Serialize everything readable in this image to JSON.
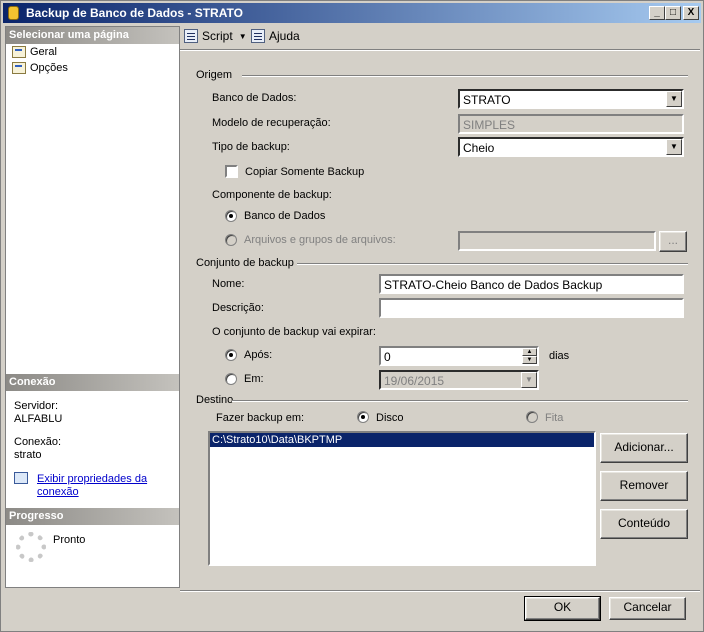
{
  "window": {
    "title": "Backup de Banco de Dados - STRATO",
    "minimize": "_",
    "maximize": "□",
    "close": "X"
  },
  "left": {
    "select_page_header": "Selecionar uma página",
    "pages": [
      {
        "label": "Geral",
        "icon": "settings-page-icon"
      },
      {
        "label": "Opções",
        "icon": "settings-page-icon"
      }
    ],
    "connection_header": "Conexão",
    "server_label": "Servidor:",
    "server_value": "ALFABLU",
    "connection_label": "Conexão:",
    "connection_value": "strato",
    "view_props_link_line1": "Exibir propriedades da",
    "view_props_link_line2": "conexão",
    "progress_header": "Progresso",
    "progress_status": "Pronto"
  },
  "toolbar": {
    "script_label": "Script",
    "help_label": "Ajuda"
  },
  "origin": {
    "group_label": "Origem",
    "database_label": "Banco de Dados:",
    "database_value": "STRATO",
    "recovery_label": "Modelo de recuperação:",
    "recovery_value": "SIMPLES",
    "backup_type_label": "Tipo de backup:",
    "backup_type_value": "Cheio",
    "copy_only_label": "Copiar Somente Backup",
    "component_label": "Componente de backup:",
    "component_db_label": "Banco de Dados",
    "component_files_label": "Arquivos e grupos de arquivos:",
    "browse_label": "..."
  },
  "backup_set": {
    "group_label": "Conjunto de backup",
    "name_label": "Nome:",
    "name_value": "STRATO-Cheio Banco de Dados Backup",
    "description_label": "Descrição:",
    "description_value": "",
    "expire_label": "O conjunto de backup vai expirar:",
    "after_label": "Após:",
    "after_value": "0",
    "days_label": "dias",
    "on_label": "Em:",
    "on_value": "19/06/2015"
  },
  "destination": {
    "group_label": "Destino",
    "backup_to_label": "Fazer backup em:",
    "disk_label": "Disco",
    "tape_label": "Fita",
    "paths": [
      "C:\\Strato10\\Data\\BKPTMP"
    ],
    "add_label": "Adicionar...",
    "remove_label": "Remover",
    "contents_label": "Conteúdo"
  },
  "footer": {
    "ok_label": "OK",
    "cancel_label": "Cancelar"
  }
}
